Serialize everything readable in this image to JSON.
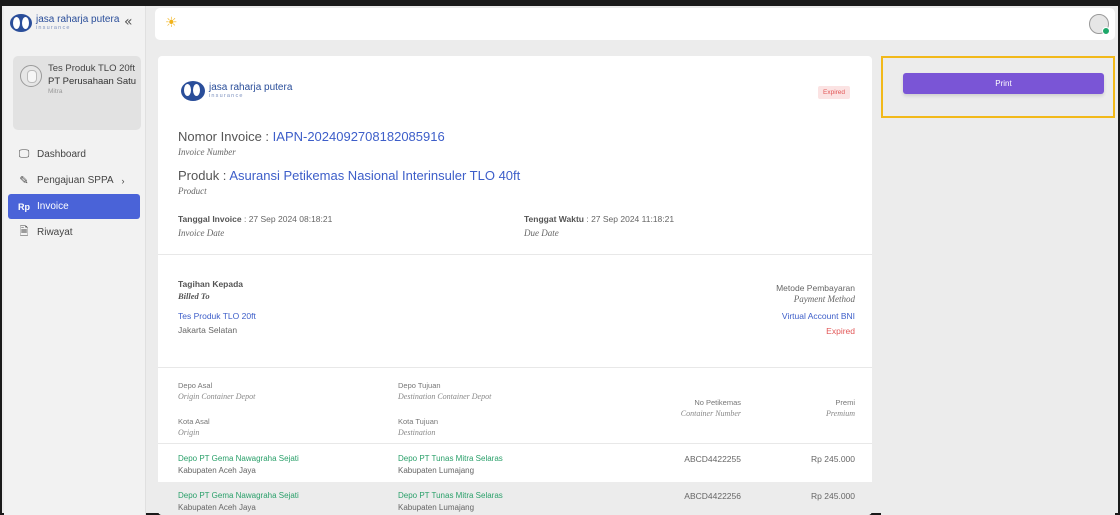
{
  "brand": {
    "name": "jasa raharja putera",
    "sub": "insurance"
  },
  "sidebar": {
    "collapse_icon": "«",
    "user": {
      "name": "Tes Produk TLO 20ft",
      "company": "PT Perusahaan Satu",
      "role": "Mitra"
    },
    "items": [
      {
        "label": "Dashboard",
        "icon": "monitor-icon",
        "glyph": "🖵"
      },
      {
        "label": "Pengajuan SPPA",
        "icon": "pencil-icon",
        "glyph": "✎",
        "arrow": "›"
      },
      {
        "label": "Invoice",
        "icon": "rupiah-icon",
        "glyph": "Rp",
        "active": true
      },
      {
        "label": "Riwayat",
        "icon": "document-icon",
        "glyph": "🗎"
      }
    ]
  },
  "topbar": {
    "theme_icon": "☀"
  },
  "invoice": {
    "status_badge": "Expired",
    "number_label": "Nomor Invoice : ",
    "number_value": "IAPN-2024092708182085916",
    "number_sub": "Invoice Number",
    "product_label": "Produk : ",
    "product_value": "Asuransi Petikemas Nasional Interinsuler TLO 40ft",
    "product_sub": "Product",
    "date_label": "Tanggal Invoice",
    "date_value": " : 27 Sep 2024 08:18:21",
    "date_sub": "Invoice Date",
    "due_label": "Tenggat Waktu",
    "due_value": " : 27 Sep 2024 11:18:21",
    "due_sub": "Due Date",
    "billed_title": "Tagihan Kepada",
    "billed_sub": "Billed To",
    "billed_name": "Tes Produk TLO 20ft",
    "billed_city": "Jakarta Selatan",
    "payment_title": "Metode Pembayaran",
    "payment_sub": "Payment Method",
    "payment_method": "Virtual Account BNI",
    "payment_status": "Expired",
    "columns": {
      "origin_depot": "Depo Asal",
      "origin_depot_en": "Origin Container Depot",
      "origin_city": "Kota Asal",
      "origin_city_en": "Origin",
      "dest_depot": "Depo Tujuan",
      "dest_depot_en": "Destination Container Depot",
      "dest_city": "Kota Tujuan",
      "dest_city_en": "Destination",
      "container": "No Petikemas",
      "container_en": "Container Number",
      "premium": "Premi",
      "premium_en": "Premium"
    },
    "rows": [
      {
        "origin_depot": "Depo PT Gema Nawagraha Sejati",
        "origin_city": "Kabupaten Aceh Jaya",
        "dest_depot": "Depo PT Tunas Mitra Selaras",
        "dest_city": "Kabupaten Lumajang",
        "container": "ABCD4422255",
        "premium": "Rp 245.000"
      },
      {
        "origin_depot": "Depo PT Gema Nawagraha Sejati",
        "origin_city": "Kabupaten Aceh Jaya",
        "dest_depot": "Depo PT Tunas Mitra Selaras",
        "dest_city": "Kabupaten Lumajang",
        "container": "ABCD4422256",
        "premium": "Rp 245.000"
      }
    ]
  },
  "actions": {
    "print_label": "Print"
  },
  "colors": {
    "accent": "#4a63d8",
    "print": "#7a55d6",
    "link": "#3d5ec9",
    "expired": "#e25757",
    "depot": "#2aa06a",
    "highlight": "#f2b91a"
  }
}
